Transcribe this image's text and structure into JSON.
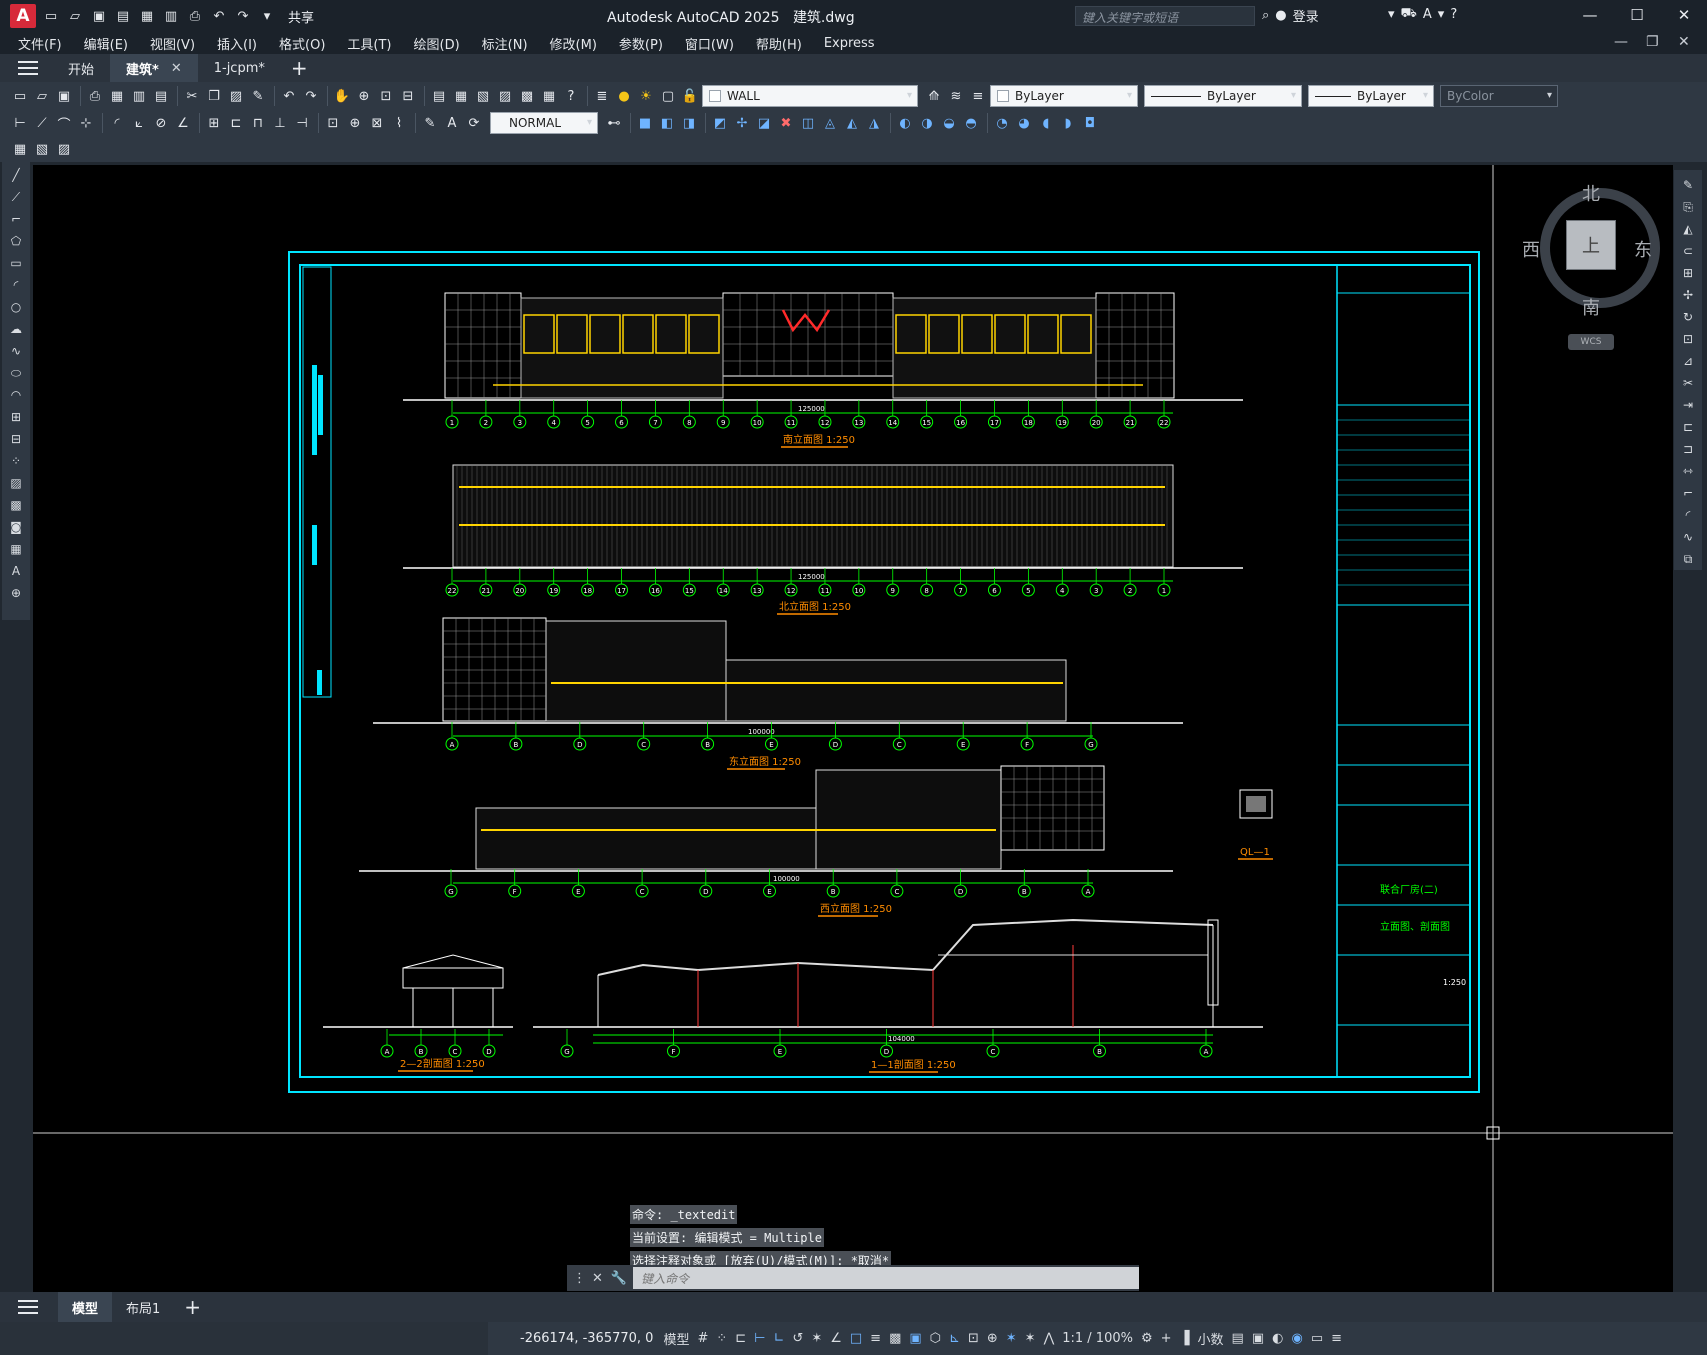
{
  "title_bar": {
    "app": "Autodesk AutoCAD 2025",
    "file": "建筑.dwg",
    "search_placeholder": "键入关键字或短语",
    "sign_in": "登录",
    "share": "共享",
    "logo_letter": "A"
  },
  "menu": [
    "文件(F)",
    "编辑(E)",
    "视图(V)",
    "插入(I)",
    "格式(O)",
    "工具(T)",
    "绘图(D)",
    "标注(N)",
    "修改(M)",
    "参数(P)",
    "窗口(W)",
    "帮助(H)",
    "Express"
  ],
  "tabs": [
    {
      "label": "开始",
      "active": false
    },
    {
      "label": "建筑*",
      "active": true
    },
    {
      "label": "1-jcpm*",
      "active": false
    }
  ],
  "properties": {
    "layer": "WALL",
    "color": "ByLayer",
    "linetype": "ByLayer",
    "lineweight": "ByLayer",
    "plotstyle": "ByColor",
    "dimstyle": "NORMAL"
  },
  "viewcube": {
    "north": "北",
    "south": "南",
    "east": "东",
    "west": "西",
    "top": "上",
    "wcs": "WCS"
  },
  "drawing": {
    "elevations": [
      {
        "title": "南立面图  1:250",
        "total_dim": "125000"
      },
      {
        "title": "北立面图  1:250",
        "total_dim": "125000"
      },
      {
        "title": "东立面图  1:250",
        "total_dim": "100000"
      },
      {
        "title": "西立面图  1:250",
        "total_dim": "100000"
      }
    ],
    "sections": [
      {
        "title": "2—2剖面图  1:250"
      },
      {
        "title": "1—1剖面图  1:250",
        "total_dim": "104000"
      }
    ],
    "detail": "QL—1",
    "axis_numbers": [
      "1",
      "2",
      "3",
      "4",
      "5",
      "6",
      "7",
      "8",
      "9",
      "10",
      "11",
      "12",
      "13",
      "14",
      "15",
      "16",
      "17",
      "18",
      "19",
      "20",
      "21",
      "22"
    ],
    "axis_letters_east": [
      "A",
      "B",
      "D",
      "C",
      "B",
      "E",
      "D",
      "C",
      "E",
      "F",
      "G"
    ],
    "section_axes_2": [
      "A",
      "B",
      "C",
      "D"
    ],
    "section_axes_1": [
      "G",
      "F",
      "E",
      "D",
      "C",
      "B",
      "A"
    ],
    "title_block": {
      "project": "联合厂房(二)",
      "sheet": "立面图、剖面图",
      "scale": "1:250"
    }
  },
  "command": {
    "history": [
      "命令: _textedit",
      "当前设置: 编辑模式 = Multiple",
      "选择注释对象或 [放弃(U)/模式(M)]: *取消*"
    ],
    "input_placeholder": "键入命令"
  },
  "layouts": [
    {
      "label": "模型",
      "active": true
    },
    {
      "label": "布局1",
      "active": false
    }
  ],
  "status": {
    "coords": "-266174, -365770, 0",
    "space": "模型",
    "scale": "1:1 / 100%",
    "units": "小数"
  }
}
